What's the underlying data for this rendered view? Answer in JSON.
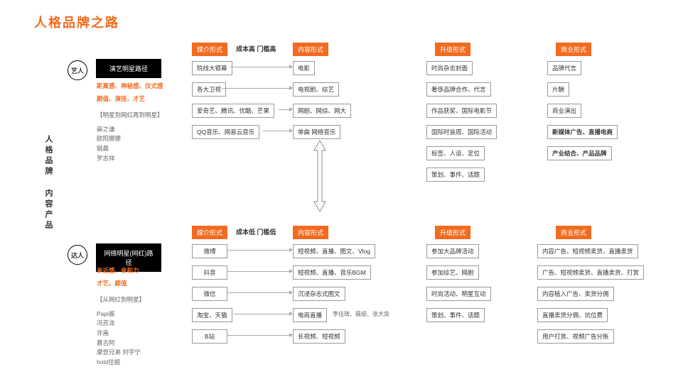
{
  "title": "人格品牌之路",
  "vertical_label": "人格品牌 内容产品",
  "circles": {
    "top": "艺人",
    "bottom": "达人"
  },
  "blackboxes": {
    "top": "演艺明星路径",
    "bottom": "网络明星(网红)路径"
  },
  "cost_labels": {
    "high": "成本高 门槛高",
    "low": "成本低 门槛低"
  },
  "headers": {
    "media": "媒介形式",
    "content": "内容形式",
    "upgrade": "升级形式",
    "biz": "商业形式"
  },
  "top_desc": {
    "orange1": "距离感、神秘感、仪式感",
    "orange2": "颜值、演技、才艺",
    "gray": "【明星到网红再到明星】",
    "names": [
      "薛之谦",
      "欧阳娜娜",
      "姚晨",
      "罗志祥"
    ]
  },
  "bottom_desc": {
    "orange1": "亲近感、亲和力",
    "orange2": "才艺、颜值",
    "gray": "【从网红到明星】",
    "names": [
      "Papi酱",
      "冯苏泷",
      "许嵩",
      "慕古阿",
      "摩登兄弟 刘宇宁",
      "hold住姐"
    ]
  },
  "rows_top": {
    "media": [
      "院线大银幕",
      "各大卫视",
      "爱奇艺、腾讯、优酷、芒果",
      "QQ音乐、网易云音乐"
    ],
    "content": [
      "电影",
      "电视剧、综艺",
      "网剧、网综、网大",
      "单曲 网络音乐"
    ],
    "upgrade": [
      "时尚杂志封面",
      "奢侈品牌合作、代言",
      "作品获奖、国际电影节",
      "国际时装周、国际活动",
      "标签、人设、定位",
      "策划、事件、话题"
    ],
    "biz": [
      "品牌代言",
      "片酬",
      "商业演出",
      "新媒体广告、直播电商",
      "产业结合、产品品牌"
    ]
  },
  "rows_bottom": {
    "media": [
      "微博",
      "抖音",
      "微信",
      "淘宝、天猫",
      "B站"
    ],
    "content": [
      "短视频、直播、图文、Vlog",
      "短视频、直播、音乐BGM",
      "沉浸杂志式图文",
      "电商直播",
      "长视频、短视频"
    ],
    "content_note": "李佳琦、薇娅、张大奕",
    "upgrade": [
      "参加大品牌活动",
      "参加综艺、网剧",
      "时尚活动、明星互动",
      "策划、事件、话题"
    ],
    "biz": [
      "内容广告、短视频卖货、直播卖货",
      "广告、短视频卖货、直播卖货、打赏",
      "内容植入广告、卖货分佣",
      "直播卖货分佣、坑位费",
      "用户打赏、视频广告分账"
    ]
  }
}
